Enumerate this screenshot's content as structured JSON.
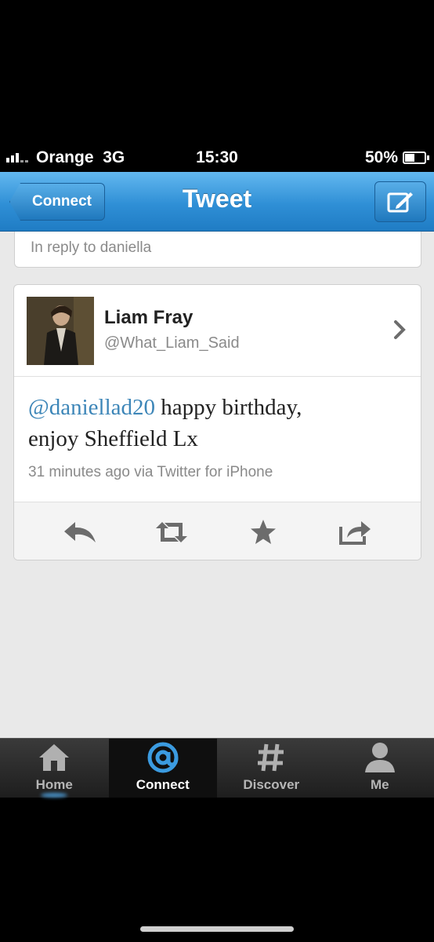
{
  "status_bar": {
    "carrier": "Orange",
    "network": "3G",
    "time": "15:30",
    "battery": "50%"
  },
  "nav_bar": {
    "back_label": "Connect",
    "title": "Tweet",
    "compose_icon": "compose-icon"
  },
  "reply_context": {
    "text": "In reply to daniella"
  },
  "tweet": {
    "author_name": "Liam Fray",
    "author_handle": "@What_Liam_Said",
    "mention": "@daniellad20",
    "body_line1": " happy birthday,",
    "body_line2": "enjoy Sheffield Lx",
    "meta": "31 minutes ago via Twitter for iPhone",
    "actions": [
      "reply-icon",
      "retweet-icon",
      "favorite-star-icon",
      "share-icon"
    ]
  },
  "tab_bar": {
    "tabs": [
      {
        "label": "Home",
        "icon": "home-icon",
        "active": false
      },
      {
        "label": "Connect",
        "icon": "at-icon",
        "active": true
      },
      {
        "label": "Discover",
        "icon": "hash-icon",
        "active": false
      },
      {
        "label": "Me",
        "icon": "person-icon",
        "active": false
      }
    ]
  },
  "colors": {
    "nav_blue": "#2f8fd6",
    "mention_blue": "#3d86b8",
    "active_tab_icon": "#3b9be0"
  }
}
